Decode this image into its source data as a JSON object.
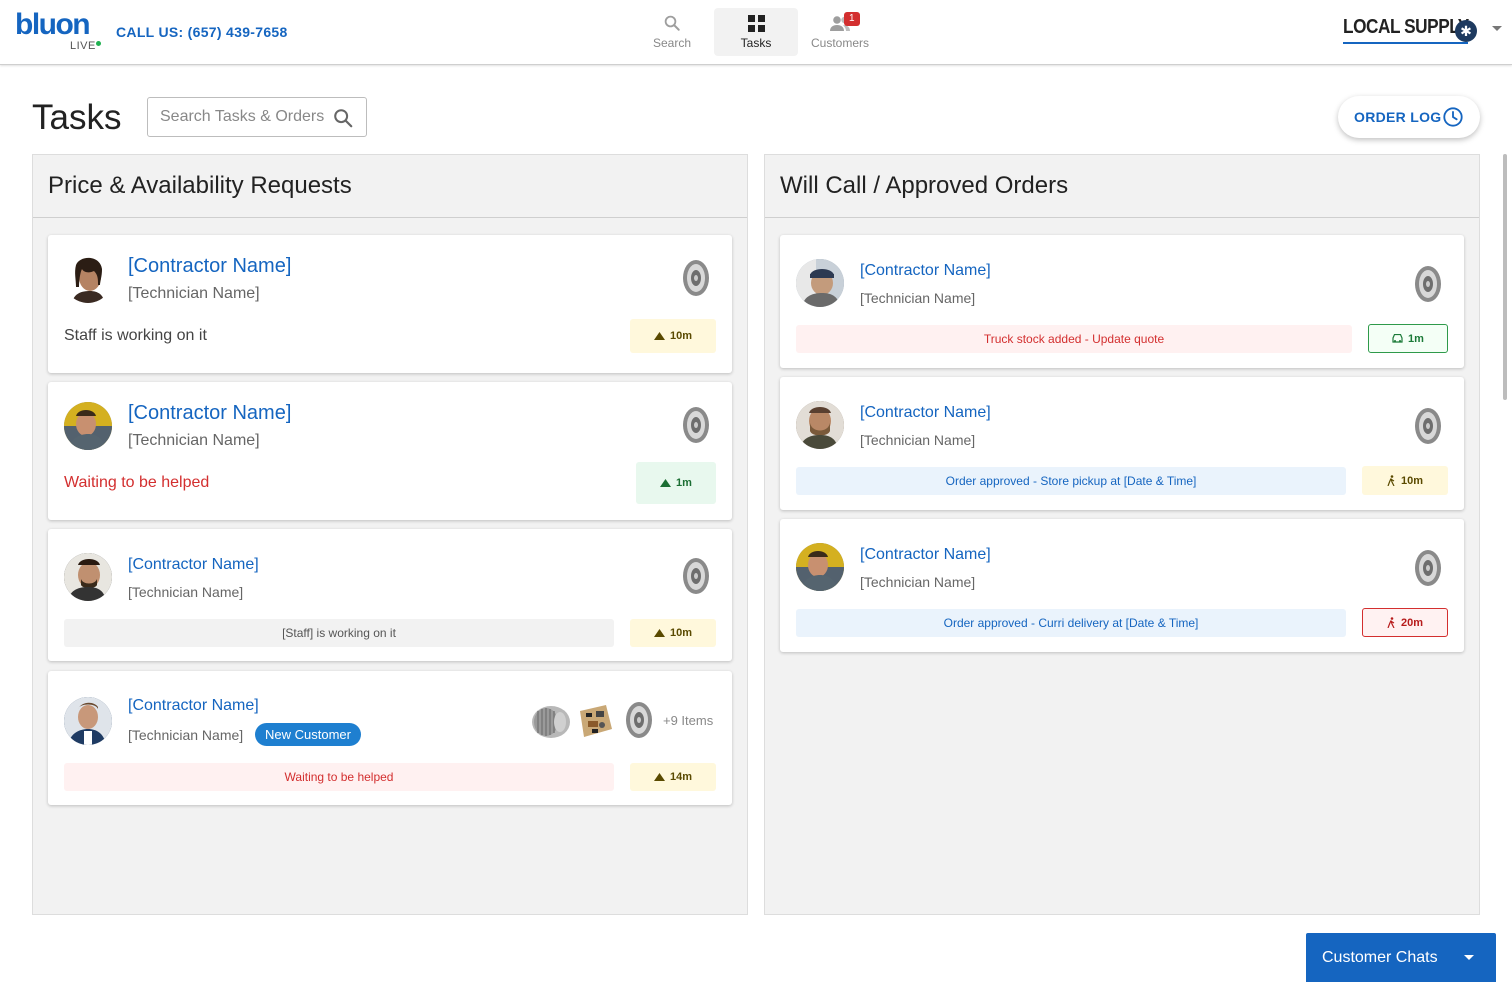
{
  "app": {
    "logo_text": "bluon",
    "logo_sub": "LIVE",
    "call_us": "CALL US: (657) 439-7658",
    "brand": "LOCAL SUPPLY"
  },
  "nav": {
    "search": "Search",
    "tasks": "Tasks",
    "customers": "Customers",
    "customers_badge": "1",
    "active": "Tasks"
  },
  "page": {
    "title": "Tasks",
    "search_placeholder": "Search Tasks & Orders",
    "order_log": "ORDER LOG"
  },
  "left_panel": {
    "title": "Price & Availability Requests",
    "cards": [
      {
        "contractor": "[Contractor Name]",
        "technician": "[Technician Name]",
        "status": "Staff is working on it",
        "timer": "10m",
        "timer_style": "yellow"
      },
      {
        "contractor": "[Contractor Name]",
        "technician": "[Technician Name]",
        "status": "Waiting to be helped",
        "timer": "1m",
        "timer_style": "green"
      },
      {
        "contractor": "[Contractor Name]",
        "technician": "[Technician Name]",
        "status": "[Staff] is working on it",
        "timer": "10m",
        "timer_style": "yellow"
      },
      {
        "contractor": "[Contractor Name]",
        "technician": "[Technician Name]",
        "tag": "New Customer",
        "more_items": "+9 Items",
        "status": "Waiting to be helped",
        "timer": "14m",
        "timer_style": "yellow"
      }
    ]
  },
  "right_panel": {
    "title": "Will Call / Approved Orders",
    "cards": [
      {
        "contractor": "[Contractor Name]",
        "technician": "[Technician Name]",
        "status": "Truck stock added - Update quote",
        "timer": "1m",
        "timer_style": "truck",
        "timer_icon": "car-icon"
      },
      {
        "contractor": "[Contractor Name]",
        "technician": "[Technician Name]",
        "status": "Order approved - Store pickup at [Date & Time]",
        "timer": "10m",
        "timer_style": "yellow",
        "timer_icon": "walking-icon"
      },
      {
        "contractor": "[Contractor Name]",
        "technician": "[Technician Name]",
        "status": "Order approved - Curri delivery at [Date & Time]",
        "timer": "20m",
        "timer_style": "red",
        "timer_icon": "walking-icon"
      }
    ]
  },
  "footer": {
    "customer_chats": "Customer Chats"
  },
  "colors": {
    "primary": "#1565c0",
    "waiting_red": "#d32f2f",
    "timer_yellow": "#fff8dc",
    "timer_green": "#e8f8ee",
    "pill_blue": "#1e7fd0"
  }
}
